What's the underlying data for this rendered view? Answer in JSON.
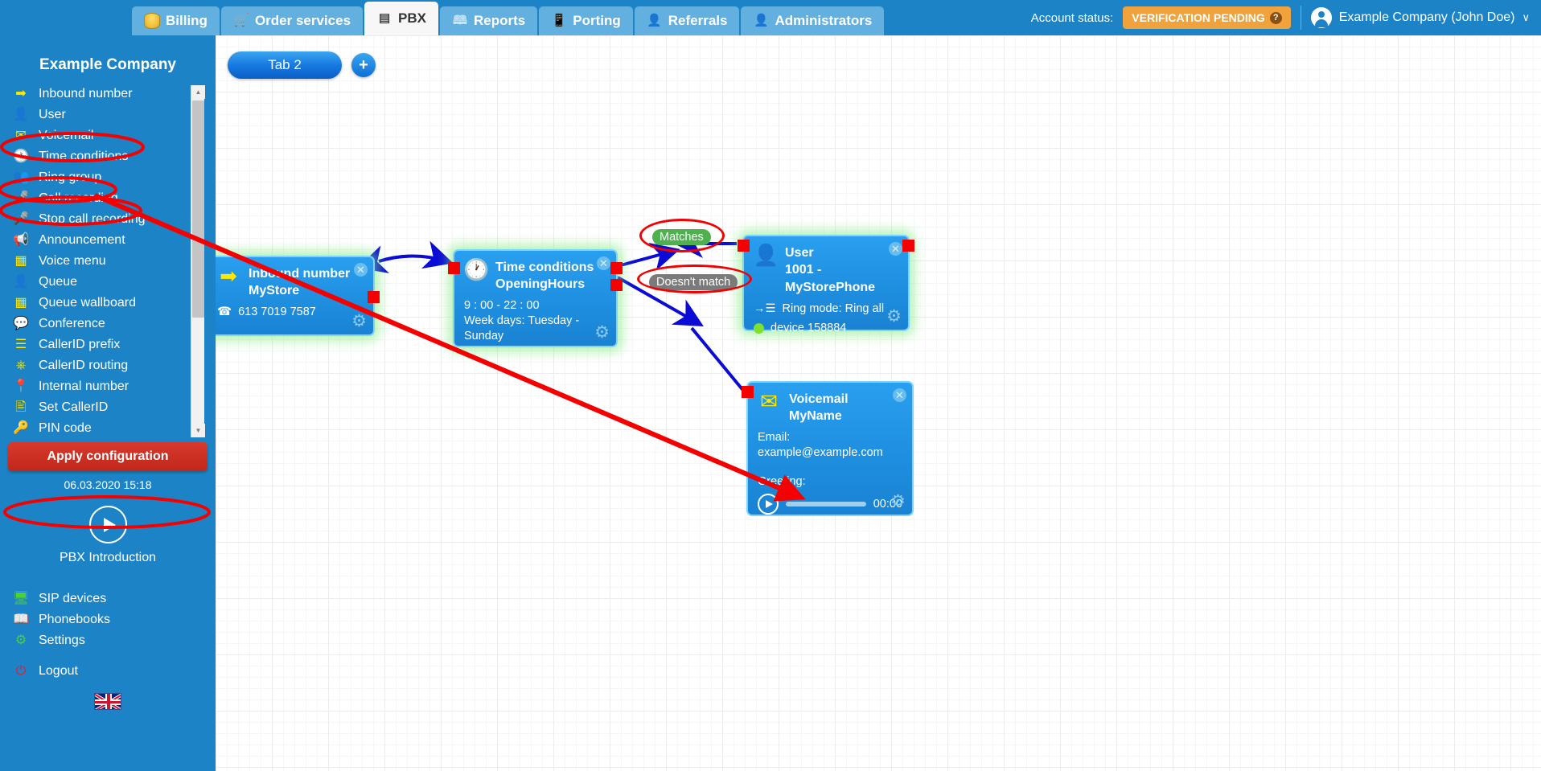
{
  "topnav": {
    "tabs": [
      {
        "label": "Billing",
        "icon": "coins-icon",
        "active": false
      },
      {
        "label": "Order services",
        "icon": "shopping-cart-icon",
        "active": false
      },
      {
        "label": "PBX",
        "icon": "pbx-switch-icon",
        "active": true
      },
      {
        "label": "Reports",
        "icon": "report-book-icon",
        "active": false
      },
      {
        "label": "Porting",
        "icon": "mobile-phone-icon",
        "active": false
      },
      {
        "label": "Referrals",
        "icon": "person-badge-icon",
        "active": false
      },
      {
        "label": "Administrators",
        "icon": "person-tie-icon",
        "active": false
      }
    ],
    "account_status_label": "Account status:",
    "status_badge": "VERIFICATION PENDING",
    "status_badge_help": "?",
    "status_badge_color": "#f0a23c",
    "user_menu": "Example Company (John Doe)",
    "user_caret": "∨",
    "avatar": "user-avatar-icon"
  },
  "sidebar": {
    "company": "Example Company",
    "menu": [
      {
        "label": "Inbound number",
        "icon": "➡",
        "highlighted": true
      },
      {
        "label": "User",
        "icon": "👤",
        "highlighted": false
      },
      {
        "label": "Voicemail",
        "icon": "✉",
        "highlighted": true
      },
      {
        "label": "Time conditions",
        "icon": "🕐",
        "highlighted": true
      },
      {
        "label": "Ring group",
        "icon": "👥",
        "highlighted": false
      },
      {
        "label": "Call recording",
        "icon": "🎤",
        "highlighted": false
      },
      {
        "label": "Stop call recording",
        "icon": "🎤",
        "highlighted": false
      },
      {
        "label": "Announcement",
        "icon": "📢",
        "highlighted": false
      },
      {
        "label": "Voice menu",
        "icon": "▒",
        "highlighted": false
      },
      {
        "label": "Queue",
        "icon": "👤",
        "highlighted": false
      },
      {
        "label": "Queue wallboard",
        "icon": "▦",
        "highlighted": false
      },
      {
        "label": "Conference",
        "icon": "💬",
        "highlighted": false
      },
      {
        "label": "CallerID prefix",
        "icon": "☰",
        "highlighted": false
      },
      {
        "label": "CallerID routing",
        "icon": "⛓",
        "highlighted": false
      },
      {
        "label": "Internal number",
        "icon": "📍",
        "highlighted": false
      },
      {
        "label": "Set CallerID",
        "icon": "🎫",
        "highlighted": false
      },
      {
        "label": "PIN code",
        "icon": "🔑",
        "highlighted": false
      }
    ],
    "scrollbar": {
      "up_arrow": "▲",
      "down_arrow": "▼"
    },
    "apply_button": "Apply configuration",
    "config_timestamp": "06.03.2020 15:18",
    "intro_label": "PBX Introduction",
    "intro_play_icon": "play-icon",
    "bottom_menu": [
      {
        "label": "SIP devices",
        "icon": "🖥"
      },
      {
        "label": "Phonebooks",
        "icon": "📖"
      },
      {
        "label": "Settings",
        "icon": "⚙"
      }
    ],
    "logout": {
      "label": "Logout",
      "icon": "⏻"
    },
    "flag": "uk-flag-icon"
  },
  "canvas": {
    "tab_label": "Tab 2",
    "add_tab_icon": "+",
    "nodes": [
      {
        "id": "inbound",
        "type": "Inbound number",
        "name": "MyStore",
        "icon": "➡",
        "detail_icon": "☎",
        "detail": "613 7019 7587",
        "close": "✕",
        "gear": "⚙"
      },
      {
        "id": "timecond",
        "type": "Time conditions",
        "name": "OpeningHours",
        "icon": "🕐",
        "line1": "9 : 00 - 22 : 00",
        "line2": "Week days: Tuesday - Sunday",
        "close": "✕",
        "gear": "⚙"
      },
      {
        "id": "user",
        "type": "User",
        "name": "1001 - MyStorePhone",
        "icon": "👤",
        "ring_mode": "Ring mode: Ring all",
        "device": "device 158884",
        "close": "✕",
        "gear": "⚙"
      },
      {
        "id": "voicemail",
        "type": "Voicemail",
        "name": "MyName",
        "icon": "✉",
        "email_label": "Email:",
        "email": "example@example.com",
        "greeting_label": "Greeting:",
        "greeting_time": "00:00",
        "close": "✕",
        "gear": "⚙"
      }
    ],
    "edge_labels": {
      "matches": "Matches",
      "doesnt_match": "Doesn't match"
    }
  },
  "colors": {
    "header_blue": "#1c84c6",
    "node_blue": "#1f8fe0",
    "accent_yellow": "#ffe800",
    "annotation_red": "#f40000",
    "match_green": "#4eb04e",
    "nomatch_gray": "#7b7b7b",
    "apply_red": "#c0271b",
    "status_orange": "#f0a23c"
  }
}
